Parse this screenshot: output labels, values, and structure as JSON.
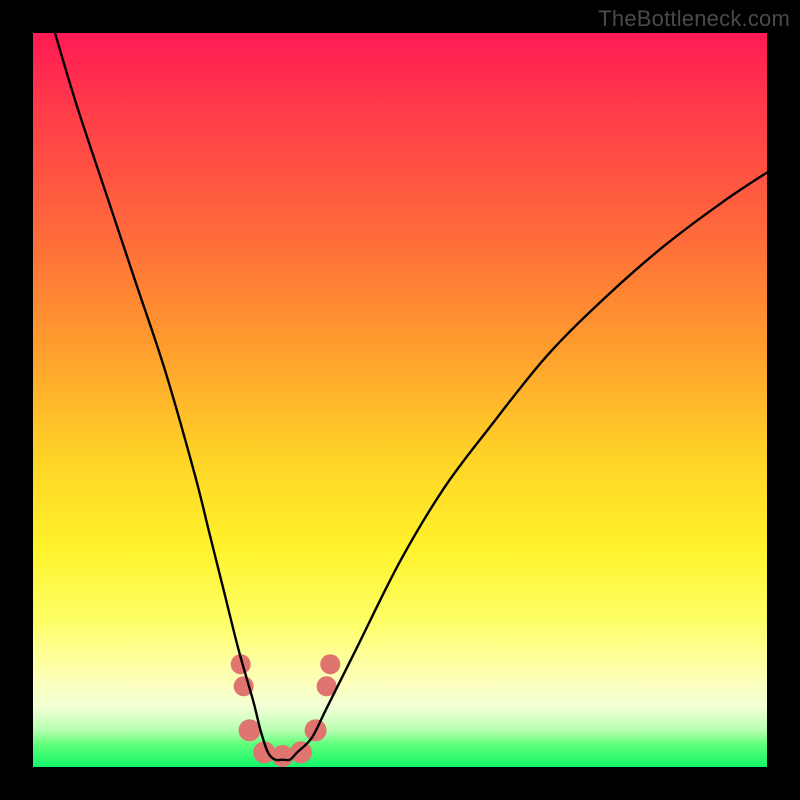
{
  "watermark": "TheBottleneck.com",
  "chart_data": {
    "type": "line",
    "title": "",
    "xlabel": "",
    "ylabel": "",
    "xlim": [
      0,
      100
    ],
    "ylim": [
      0,
      100
    ],
    "grid": false,
    "legend": null,
    "series": [
      {
        "name": "bottleneck-curve",
        "color": "#000000",
        "x": [
          3,
          6,
          10,
          14,
          18,
          22,
          24,
          26,
          28,
          30,
          31,
          32,
          33,
          34,
          35,
          36,
          38,
          40,
          44,
          50,
          56,
          62,
          70,
          78,
          86,
          94,
          100
        ],
        "y": [
          100,
          90,
          78,
          66,
          54,
          40,
          32,
          24,
          16,
          9,
          5,
          2,
          1,
          1,
          1,
          2,
          4,
          8,
          16,
          28,
          38,
          46,
          56,
          64,
          71,
          77,
          81
        ]
      }
    ],
    "markers": [
      {
        "name": "dot-left-upper",
        "x": 28.3,
        "y": 14,
        "color": "#e0746f",
        "r": 10
      },
      {
        "name": "dot-left-lower",
        "x": 28.7,
        "y": 11,
        "color": "#e0746f",
        "r": 10
      },
      {
        "name": "dot-floor-1",
        "x": 29.5,
        "y": 5,
        "color": "#e0746f",
        "r": 11
      },
      {
        "name": "dot-floor-2",
        "x": 31.5,
        "y": 2,
        "color": "#e0746f",
        "r": 11
      },
      {
        "name": "dot-floor-3",
        "x": 34.0,
        "y": 1.5,
        "color": "#e0746f",
        "r": 11
      },
      {
        "name": "dot-floor-4",
        "x": 36.5,
        "y": 2,
        "color": "#e0746f",
        "r": 11
      },
      {
        "name": "dot-floor-5",
        "x": 38.5,
        "y": 5,
        "color": "#e0746f",
        "r": 11
      },
      {
        "name": "dot-right-lower",
        "x": 40.0,
        "y": 11,
        "color": "#e0746f",
        "r": 10
      },
      {
        "name": "dot-right-upper",
        "x": 40.5,
        "y": 14,
        "color": "#e0746f",
        "r": 10
      }
    ]
  }
}
